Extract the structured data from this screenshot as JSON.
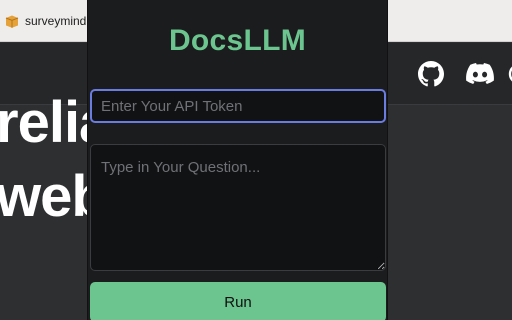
{
  "background_page": {
    "tab_title": "surveymind",
    "hero_line1": "relia          o-end",
    "hero_line2": "web"
  },
  "icons": [
    "package-icon",
    "github-icon",
    "discord-icon"
  ],
  "popup": {
    "title": "DocsLLM",
    "token_input": {
      "value": "",
      "placeholder": "Enter Your API Token"
    },
    "question_input": {
      "value": "",
      "placeholder": "Type in Your Question..."
    },
    "run_label": "Run"
  },
  "colors": {
    "accent": "#6cc48e",
    "focus_border": "#6a7ce0",
    "popup_bg": "#1b1c1e",
    "page_bg": "#2e2f31"
  }
}
